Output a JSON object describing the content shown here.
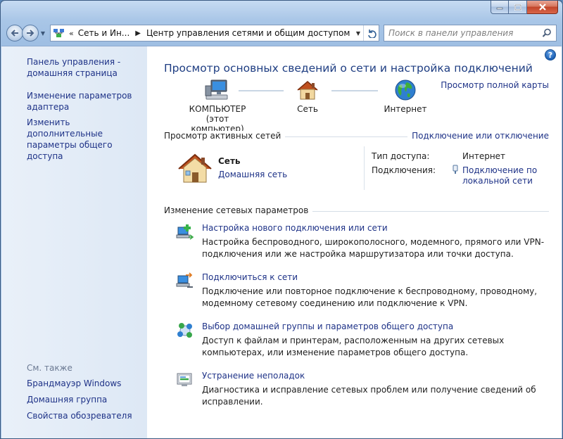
{
  "titlebar": {
    "controls": [
      "minimize",
      "maximize",
      "close"
    ]
  },
  "address": {
    "overflow": "«",
    "segments": [
      "Сеть и Ин...",
      "Центр управления сетями и общим доступом"
    ],
    "search_placeholder": "Поиск в панели управления"
  },
  "sidebar": {
    "links": [
      {
        "label": "Панель управления -\nдомашняя страница"
      },
      {
        "label": "Изменение параметров\nадаптера"
      },
      {
        "label": "Изменить дополнительные\nпараметры общего доступа"
      }
    ],
    "see_also_title": "См. также",
    "see_also": [
      {
        "label": "Брандмауэр Windows"
      },
      {
        "label": "Домашняя группа"
      },
      {
        "label": "Свойства обозревателя"
      }
    ]
  },
  "main": {
    "title": "Просмотр основных сведений о сети и настройка подключений",
    "full_map_link": "Просмотр полной карты",
    "map": {
      "computer": "КОМПЬЮТЕР",
      "computer_sub": "(этот компьютер)",
      "network": "Сеть",
      "internet": "Интернет"
    },
    "active_networks": {
      "section_title": "Просмотр активных сетей",
      "connect_link": "Подключение или отключение",
      "network_name": "Сеть",
      "network_type": "Домашняя сеть",
      "access_type_label": "Тип доступа:",
      "access_type_value": "Интернет",
      "connections_label": "Подключения:",
      "connections_value": "Подключение по\nлокальной сети"
    },
    "change_settings": {
      "section_title": "Изменение сетевых параметров",
      "tasks": [
        {
          "icon": "new-connection-icon",
          "link": "Настройка нового подключения или сети",
          "desc": "Настройка беспроводного, широкополосного, модемного, прямого или VPN-подключения или же настройка маршрутизатора или точки доступа."
        },
        {
          "icon": "connect-network-icon",
          "link": "Подключиться к сети",
          "desc": "Подключение или повторное подключение к беспроводному, проводному, модемному сетевому соединению или подключение к VPN."
        },
        {
          "icon": "homegroup-icon",
          "link": "Выбор домашней группы и параметров общего доступа",
          "desc": "Доступ к файлам и принтерам, расположенным на других сетевых компьютерах, или изменение параметров общего доступа."
        },
        {
          "icon": "troubleshoot-icon",
          "link": "Устранение неполадок",
          "desc": "Диагностика и исправление сетевых проблем или получение сведений об исправлении."
        }
      ]
    }
  },
  "colors": {
    "link": "#1e3287",
    "title": "#1e3d82",
    "sidebar_bg": "#dde8f5",
    "frame": "#9fbfe3"
  }
}
